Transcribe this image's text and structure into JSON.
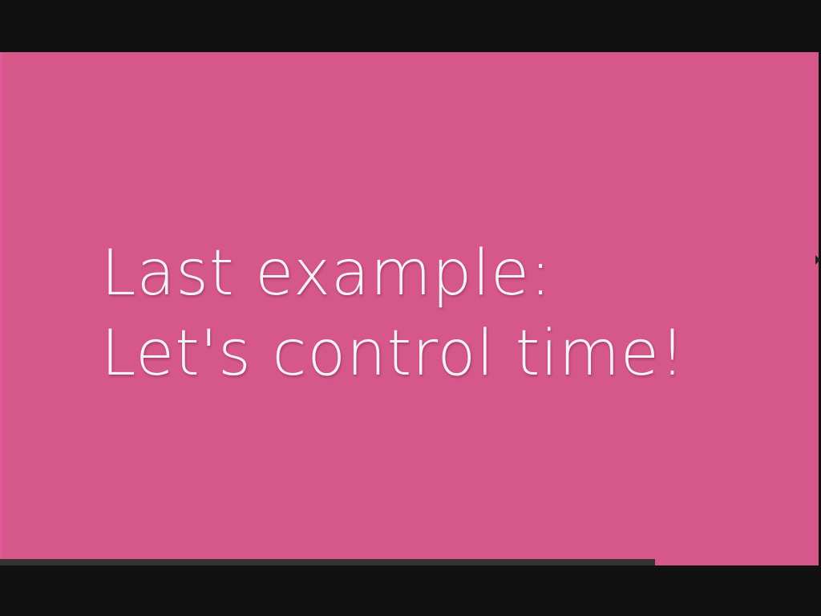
{
  "slide": {
    "line1": "Last example:",
    "line2": "Let's control time!",
    "background_color": "#d6588b",
    "text_color": "#f6f2f4"
  },
  "progress": {
    "fraction": 0.8,
    "color": "#333333"
  },
  "cursor": {
    "icon": "mouse-pointer-icon"
  }
}
